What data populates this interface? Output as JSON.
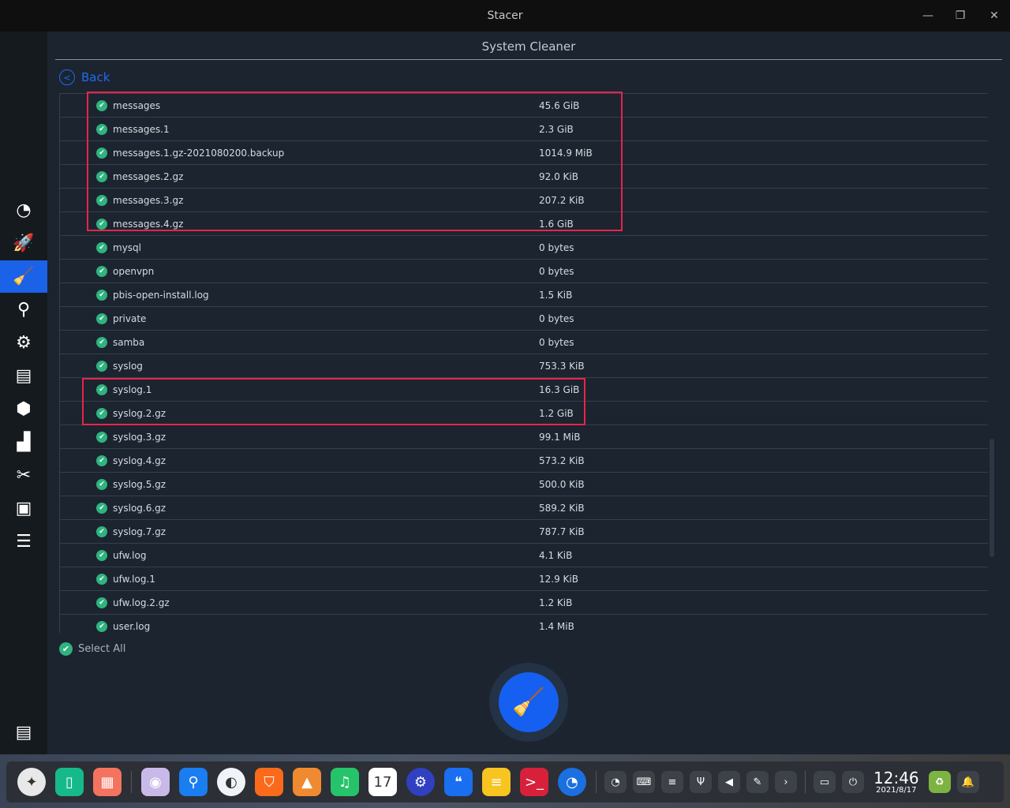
{
  "window": {
    "title": "Stacer",
    "minimize": "—",
    "maximize": "❐",
    "close": "✕"
  },
  "page": {
    "title": "System Cleaner",
    "back_label": "Back",
    "select_all_label": "Select All"
  },
  "colors": {
    "accent": "#1a62e8",
    "check": "#2fb37f",
    "highlight": "#e8234a"
  },
  "sidebar": {
    "items": [
      {
        "icon": "dashboard-icon",
        "glyph": "◔"
      },
      {
        "icon": "startup-apps-icon",
        "glyph": "🚀"
      },
      {
        "icon": "system-cleaner-icon",
        "glyph": "🧹",
        "selected": true
      },
      {
        "icon": "search-icon",
        "glyph": "⚲"
      },
      {
        "icon": "services-icon",
        "glyph": "⚙"
      },
      {
        "icon": "processes-icon",
        "glyph": "▤"
      },
      {
        "icon": "uninstaller-icon",
        "glyph": "⬢"
      },
      {
        "icon": "resources-icon",
        "glyph": "▟"
      },
      {
        "icon": "helpers-icon",
        "glyph": "✂"
      },
      {
        "icon": "apt-repository-icon",
        "glyph": "▣"
      },
      {
        "icon": "settings-icon",
        "glyph": "☰"
      }
    ],
    "feedback_icon": "feedback-icon"
  },
  "files": [
    {
      "name": "messages",
      "size": "45.6 GiB"
    },
    {
      "name": "messages.1",
      "size": "2.3 GiB"
    },
    {
      "name": "messages.1.gz-2021080200.backup",
      "size": "1014.9 MiB"
    },
    {
      "name": "messages.2.gz",
      "size": "92.0 KiB"
    },
    {
      "name": "messages.3.gz",
      "size": "207.2 KiB"
    },
    {
      "name": "messages.4.gz",
      "size": "1.6 GiB"
    },
    {
      "name": "mysql",
      "size": "0 bytes"
    },
    {
      "name": "openvpn",
      "size": "0 bytes"
    },
    {
      "name": "pbis-open-install.log",
      "size": "1.5 KiB"
    },
    {
      "name": "private",
      "size": "0 bytes"
    },
    {
      "name": "samba",
      "size": "0 bytes"
    },
    {
      "name": "syslog",
      "size": "753.3 KiB"
    },
    {
      "name": "syslog.1",
      "size": "16.3 GiB"
    },
    {
      "name": "syslog.2.gz",
      "size": "1.2 GiB"
    },
    {
      "name": "syslog.3.gz",
      "size": "99.1 MiB"
    },
    {
      "name": "syslog.4.gz",
      "size": "573.2 KiB"
    },
    {
      "name": "syslog.5.gz",
      "size": "500.0 KiB"
    },
    {
      "name": "syslog.6.gz",
      "size": "589.2 KiB"
    },
    {
      "name": "syslog.7.gz",
      "size": "787.7 KiB"
    },
    {
      "name": "ufw.log",
      "size": "4.1 KiB"
    },
    {
      "name": "ufw.log.1",
      "size": "12.9 KiB"
    },
    {
      "name": "ufw.log.2.gz",
      "size": "1.2 KiB"
    },
    {
      "name": "user.log",
      "size": "1.4 MiB"
    }
  ],
  "taskbar": {
    "apps": [
      {
        "icon": "launcher-icon",
        "bg": "#e8e8e8",
        "glyph": "✦"
      },
      {
        "icon": "multitasking-icon",
        "bg": "#16b98a",
        "glyph": "▯"
      },
      {
        "icon": "workspace-icon",
        "bg": "#f4735f",
        "glyph": "▦"
      },
      {
        "icon": "camera-icon",
        "bg": "#c9b9e8",
        "glyph": "◉"
      },
      {
        "icon": "file-manager-icon",
        "bg": "#1a7df0",
        "glyph": "⚲"
      },
      {
        "icon": "browser-icon",
        "bg": "#f0f4f8",
        "glyph": "◐"
      },
      {
        "icon": "app-store-icon",
        "bg": "#fa6a1a",
        "glyph": "⛉"
      },
      {
        "icon": "image-viewer-icon",
        "bg": "#f08a30",
        "glyph": "▲"
      },
      {
        "icon": "music-icon",
        "bg": "#26c46a",
        "glyph": "♫"
      },
      {
        "icon": "calendar-icon",
        "bg": "#ffffff",
        "glyph": "17"
      },
      {
        "icon": "control-center-icon",
        "bg": "#3040c0",
        "glyph": "⚙"
      },
      {
        "icon": "chat-icon",
        "bg": "#1a6ef0",
        "glyph": "❝"
      },
      {
        "icon": "notes-icon",
        "bg": "#f8c420",
        "glyph": "≡"
      },
      {
        "icon": "terminal-icon",
        "bg": "#d8203a",
        "glyph": ">_"
      },
      {
        "icon": "stacer-icon",
        "bg": "#1a70e0",
        "glyph": "◔"
      }
    ],
    "tray": [
      {
        "icon": "system-monitor-icon",
        "glyph": "◔"
      },
      {
        "icon": "keyboard-icon",
        "glyph": "⌨"
      },
      {
        "icon": "sticky-notes-icon",
        "glyph": "≡"
      },
      {
        "icon": "usb-icon",
        "glyph": "Ψ"
      },
      {
        "icon": "volume-icon",
        "glyph": "◀"
      },
      {
        "icon": "screen-picker-icon",
        "glyph": "✎"
      },
      {
        "icon": "expand-arrow-icon",
        "glyph": "›"
      }
    ],
    "tray2": [
      {
        "icon": "onboard-keyboard-icon",
        "glyph": "▭"
      },
      {
        "icon": "power-icon",
        "glyph": "⏻"
      }
    ],
    "time": "12:46",
    "date": "2021/8/17",
    "trash_icon": "trash-icon",
    "notification_icon": "bell-icon"
  }
}
